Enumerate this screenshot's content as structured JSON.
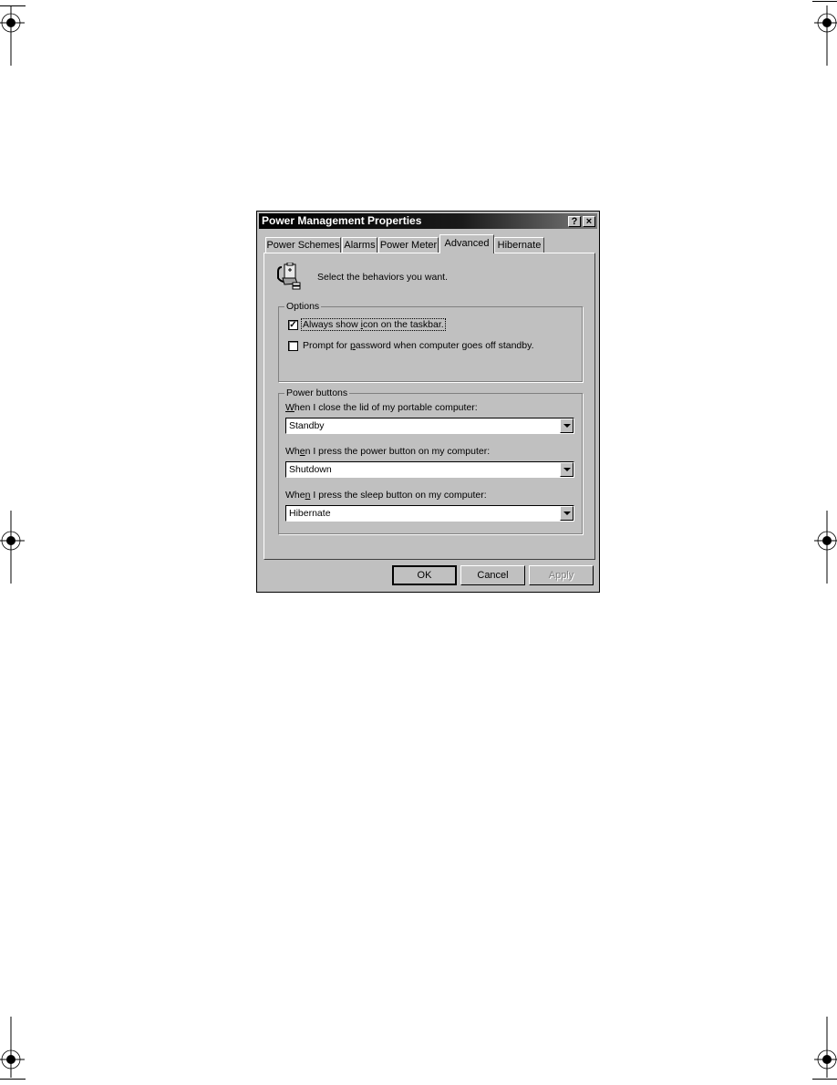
{
  "window": {
    "title": "Power Management Properties",
    "help_button": "?",
    "close_button": "×"
  },
  "tabs": [
    {
      "label": "Power Schemes",
      "active": false
    },
    {
      "label": "Alarms",
      "active": false
    },
    {
      "label": "Power Meter",
      "active": false
    },
    {
      "label": "Advanced",
      "active": true
    },
    {
      "label": "Hibernate",
      "active": false
    }
  ],
  "header": {
    "icon": "power-plug-battery-icon",
    "text": "Select the behaviors you want."
  },
  "options": {
    "label": "Options",
    "items": [
      {
        "label": "Always show icon on the taskbar.",
        "checked": true,
        "focused": true
      },
      {
        "label": "Prompt for password when computer goes off standby.",
        "checked": false,
        "focused": false
      }
    ]
  },
  "power_buttons": {
    "label": "Power buttons",
    "fields": [
      {
        "label": "When I close the lid of my portable computer:",
        "value": "Standby"
      },
      {
        "label": "When I press the power button on my computer:",
        "value": "Shutdown"
      },
      {
        "label": "When I press the sleep button on my computer:",
        "value": "Hibernate"
      }
    ]
  },
  "buttons": {
    "ok": "OK",
    "cancel": "Cancel",
    "apply": "Apply",
    "apply_enabled": false
  }
}
